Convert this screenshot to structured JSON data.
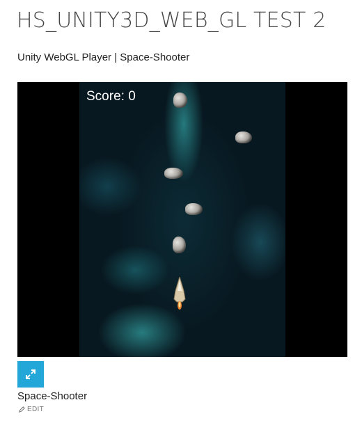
{
  "page": {
    "title": "HS_UNITY3D_WEB_GL TEST 2",
    "subtitle": "Unity WebGL Player | Space-Shooter"
  },
  "game": {
    "score_text": "Score: 0",
    "objects": [
      "asteroid",
      "asteroid",
      "asteroid",
      "asteroid",
      "asteroid",
      "player-ship"
    ]
  },
  "footer": {
    "fullscreen_icon": "expand-arrows-icon",
    "item_title": "Space-Shooter",
    "edit_icon": "pencil-icon",
    "edit_label": "EDIT"
  },
  "colors": {
    "accent": "#23a7d9",
    "player_bg": "#000000",
    "nebula": "#0c2b36"
  }
}
